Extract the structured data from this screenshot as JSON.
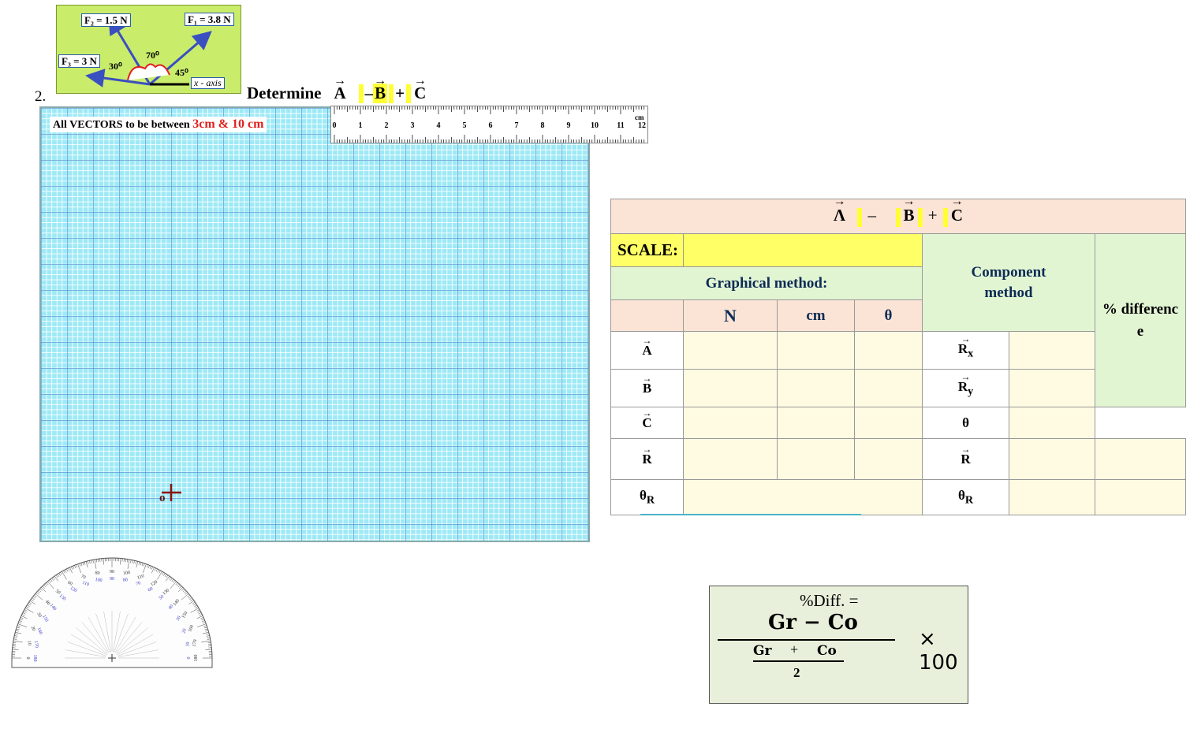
{
  "force_diagram": {
    "f1": "F₁ = 3.8 N",
    "f2": "F₂ = 1.5 N",
    "f3": "F₃ = 3 N",
    "angle1": "70⁰",
    "angle2": "30⁰",
    "angle3": "45⁰",
    "axis": "x - axis"
  },
  "question": {
    "number": "2.",
    "verb": "Determine",
    "expr": {
      "a": "A",
      "op1": "–",
      "b": "B",
      "op2": "+",
      "c": "C"
    }
  },
  "grid": {
    "note": "All VECTORS to be between ",
    "range": "3cm & 10 cm",
    "origin": "o"
  },
  "ruler": {
    "unit": "cm",
    "ticks": [
      "0",
      "1",
      "2",
      "3",
      "4",
      "5",
      "6",
      "7",
      "8",
      "9",
      "10",
      "11",
      "12"
    ]
  },
  "protractor": {
    "outer_labels": [
      "0",
      "10",
      "20",
      "30",
      "40",
      "50",
      "60",
      "70",
      "80",
      "90",
      "100",
      "110",
      "120",
      "130",
      "140",
      "150",
      "160",
      "170",
      "180"
    ],
    "inner_labels": [
      "180",
      "170",
      "160",
      "150",
      "140",
      "130",
      "120",
      "110",
      "100",
      "90",
      "80",
      "70",
      "60",
      "50",
      "40",
      "30",
      "20",
      "10",
      "0"
    ]
  },
  "table": {
    "title": {
      "a": "Λ",
      "op1": "–",
      "b": "B",
      "op2": "+",
      "c": "C"
    },
    "scale_label": "SCALE:",
    "scale_value": "",
    "graphical_label": "Graphical  method:",
    "component_label": "Component method",
    "percent_label": "% differenc e",
    "col_n": "N",
    "col_cm": "cm",
    "col_theta": "θ",
    "rows": [
      {
        "label": "A",
        "comp": "R",
        "comp_sub": "x"
      },
      {
        "label": "B",
        "comp": "R",
        "comp_sub": "y"
      },
      {
        "label": "C",
        "comp": "θ",
        "comp_sub": ""
      },
      {
        "label": "R",
        "comp": "R",
        "comp_sub": ""
      },
      {
        "label": "θ",
        "label_sub": "R",
        "comp": "θ",
        "comp_sub": "R"
      }
    ]
  },
  "formula": {
    "title": "%Diff. =",
    "numerator": "Gr − Co",
    "inner_num_left": "Gr",
    "inner_plus": "+",
    "inner_num_right": "Co",
    "inner_den": "2",
    "multiplier": "× 100"
  },
  "colors": {
    "diagram_bg": "#c9ec6a",
    "grid_bg": "#9ee9f6",
    "highlight": "#ffff33",
    "table_header": "#fbe4d5",
    "table_green": "#e2f5d3",
    "table_cream": "#fffbe3",
    "formula_bg": "#e8efdb"
  }
}
